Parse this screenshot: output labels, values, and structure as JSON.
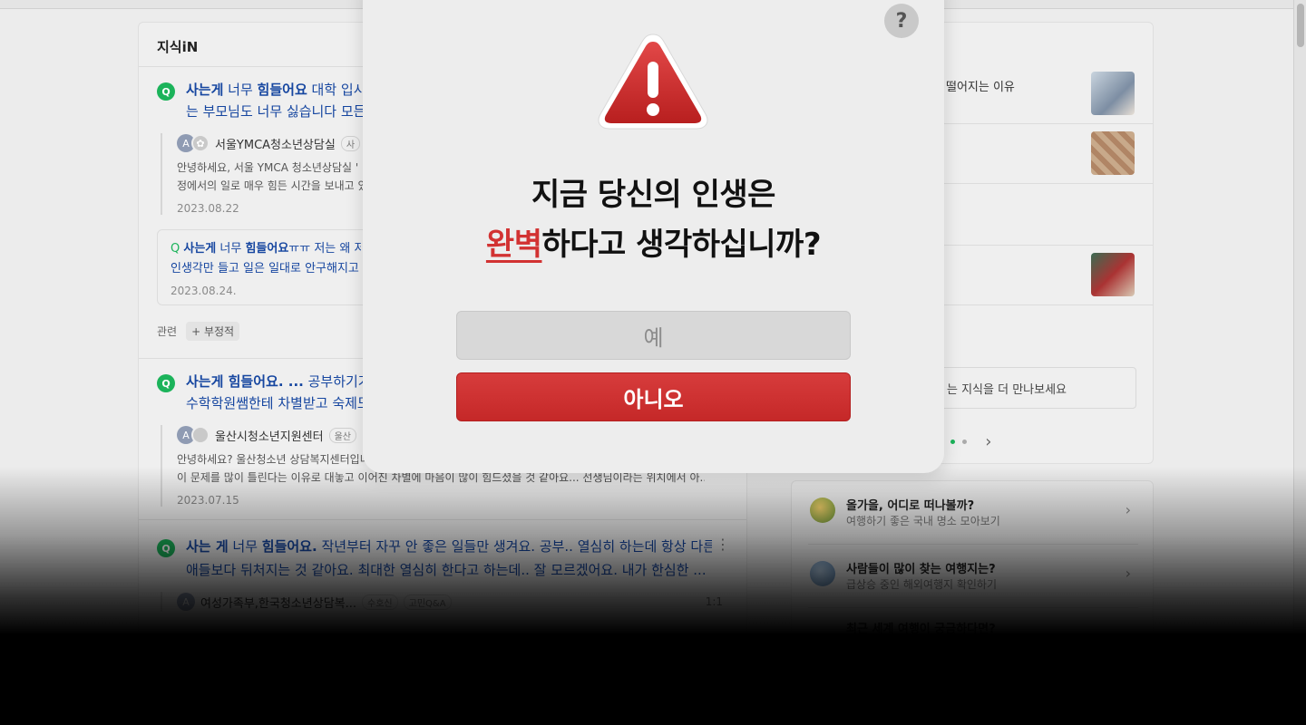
{
  "kin": {
    "title": "지식iN",
    "q1": {
      "title_hl1": "사는게",
      "title_mid": " 너무 ",
      "title_hl2": "힘들어요",
      "title_rest": " 대학 입시!",
      "title_line2": "는 부모님도 너무 싫습니다 모든거",
      "answerer": "서울YMCA청소년상담실",
      "answer_tag": "사",
      "answer_line1": "안녕하세요, 서울 YMCA 청소년상담실 '",
      "answer_line2": "정에서의 일로 매우 힘든 시간을 보내고 있",
      "date": "2023.08.22"
    },
    "q1_sub": {
      "title_hl1": "사는게",
      "title_mid": " 너무 ",
      "title_hl2": "힘들어요",
      "title_rest": "ㅠㅠ 저는 왜 저",
      "title_line2": "인생각만 들고 일은 일대로 안구해지고 '",
      "date": "2023.08.24."
    },
    "related": {
      "label": "관련",
      "chip": "+ 부정적"
    },
    "q2": {
      "title_hl": "사는게 힘들어요. ...",
      "title_rest": " 공부하기가",
      "title_line2": "수학학원쌤한테 차별받고 숙제도",
      "answerer": "울산시청소년지원센터",
      "answer_tag": "울산",
      "answer_line1": "안녕하세요? 울산청소년 상담복지센터입니",
      "answer_line2": "이 문제를 많이 틀린다는 이유로 대놓고 이어진 차별에 마음이 많이 힘드셨을 것 같아요... 선생님이라는 위치에서 아...",
      "date": "2023.07.15"
    },
    "q3": {
      "title_hl1": "사는 게",
      "title_mid": " 너무 ",
      "title_hl2": "힘들어요.",
      "title_rest": " 작년부터 자꾸 안 좋은 일들만 생겨요. 공부.. 열심히 하는데 항상 다른",
      "title_line2": "애들보다 뒤처지는 것 같아요. 최대한 열심히 한다고 하는데.. 잘 모르겠어요. 내가 한심한 ...",
      "answerer": "여성가족부,한국청소년상담복...",
      "answer_tag": "수호신",
      "answer_tag2": "고민Q&A",
      "answer_count": "1:1"
    }
  },
  "side": {
    "row1_text": "떨어지는 이유",
    "more_text": "는 지식을 더 만나보세요"
  },
  "travel": {
    "item1_title": "올가을, 어디로 떠나볼까?",
    "item1_sub": "여행하기 좋은 국내 명소 모아보기",
    "item2_title": "사람들이 많이 찾는 여행지는?",
    "item2_sub": "급상승 중인 해외여행지 확인하기",
    "item3_title": "최근 세계 여행이 궁금하다면?"
  },
  "modal": {
    "help_label": "?",
    "question_line1": "지금 당신의 인생은",
    "question_highlight": "완벽",
    "question_line2_rest": "하다고 생각하십니까?",
    "yes_label": "예",
    "no_label": "아니오"
  },
  "colors": {
    "accent_red": "#d23232",
    "kin_green": "#1bb35a",
    "link_blue": "#1646a0"
  }
}
